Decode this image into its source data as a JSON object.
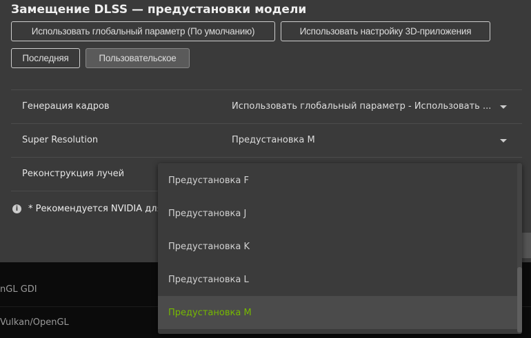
{
  "title": "Замещение DLSS — предустановки модели",
  "buttons": [
    {
      "label": "Использовать глобальный параметр (По умолчанию)"
    },
    {
      "label": "Использовать настройку 3D-приложения"
    },
    {
      "label": "Последняя"
    },
    {
      "label": "Пользовательское",
      "active": true
    }
  ],
  "rows": [
    {
      "label": "Генерация кадров",
      "value": "Использовать глобальный параметр - Использовать ..."
    },
    {
      "label": "Super Resolution",
      "value": "Предустановка M"
    },
    {
      "label": "Реконструкция лучей",
      "value": ""
    }
  ],
  "note": "* Рекомендуется NVIDIA для",
  "background_rows": [
    "nGL GDI",
    "Vulkan/OpenGL"
  ],
  "dropdown": {
    "options": [
      "Предустановка F",
      "Предустановка J",
      "Предустановка K",
      "Предустановка L",
      "Предустановка M"
    ],
    "selected": "Предустановка M"
  },
  "colors": {
    "accent": "#76b900",
    "panel": "#3a3a3a",
    "background": "#0b0b0b"
  }
}
